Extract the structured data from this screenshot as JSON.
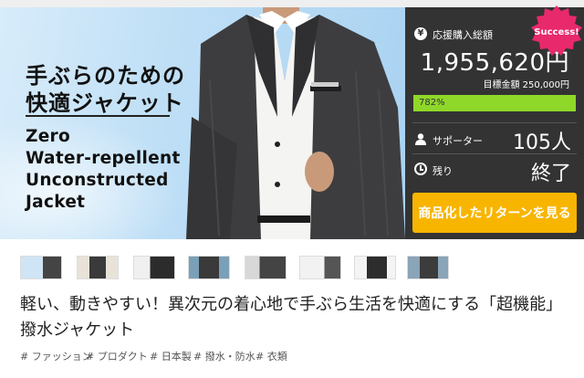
{
  "hero": {
    "headline_line1": "手ぶらのための",
    "headline_line2": "快適ジャケット",
    "english_line1": "Zero",
    "english_line2": "Water-repellent",
    "english_line3": "Unconstructed",
    "english_line4": "Jacket"
  },
  "panel": {
    "badge": "Success!",
    "yen_icon": "¥",
    "raised_label": "応援購入総額",
    "raised_amount": "1,955,620円",
    "target_label": "目標金額 250,000円",
    "progress_text": "782%",
    "progress_fraction": 1.0,
    "supporters_label": "サポーター",
    "supporters_value": "105人",
    "remaining_label": "残り",
    "remaining_value": "終了",
    "cta_label": "商品化したリターンを見る"
  },
  "icons": {
    "yen": "yen-icon",
    "supporter": "person-icon",
    "clock": "clock-icon"
  },
  "title": "軽い、動きやすい！異次元の着心地で手ぶら生活を快適にする「超機能」撥水ジャケット",
  "tags": [
    "# ファッション",
    "# プロダクト",
    "# 日本製",
    "# 撥水・防水",
    "# 衣類"
  ],
  "colors": {
    "panel_bg": "#333333",
    "progress_green": "#8fd82a",
    "cta_orange": "#f8b500",
    "badge_pink": "#e8296c"
  }
}
